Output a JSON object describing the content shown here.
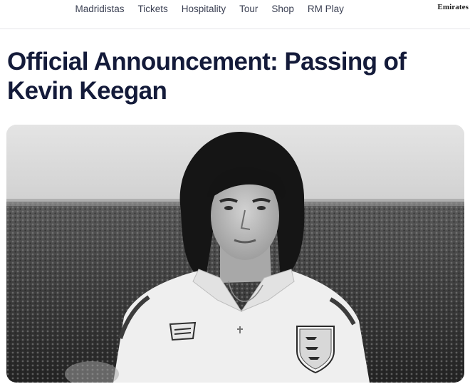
{
  "nav": {
    "items": [
      {
        "label": "Madridistas"
      },
      {
        "label": "Tickets"
      },
      {
        "label": "Hospitality"
      },
      {
        "label": "Tour"
      },
      {
        "label": "Shop"
      },
      {
        "label": "RM Play"
      }
    ],
    "sponsor": "Emirates"
  },
  "article": {
    "title": "Official Announcement: Passing of Kevin Keegan"
  },
  "colors": {
    "headline": "#141b3a",
    "nav_text": "#3a3f52"
  }
}
